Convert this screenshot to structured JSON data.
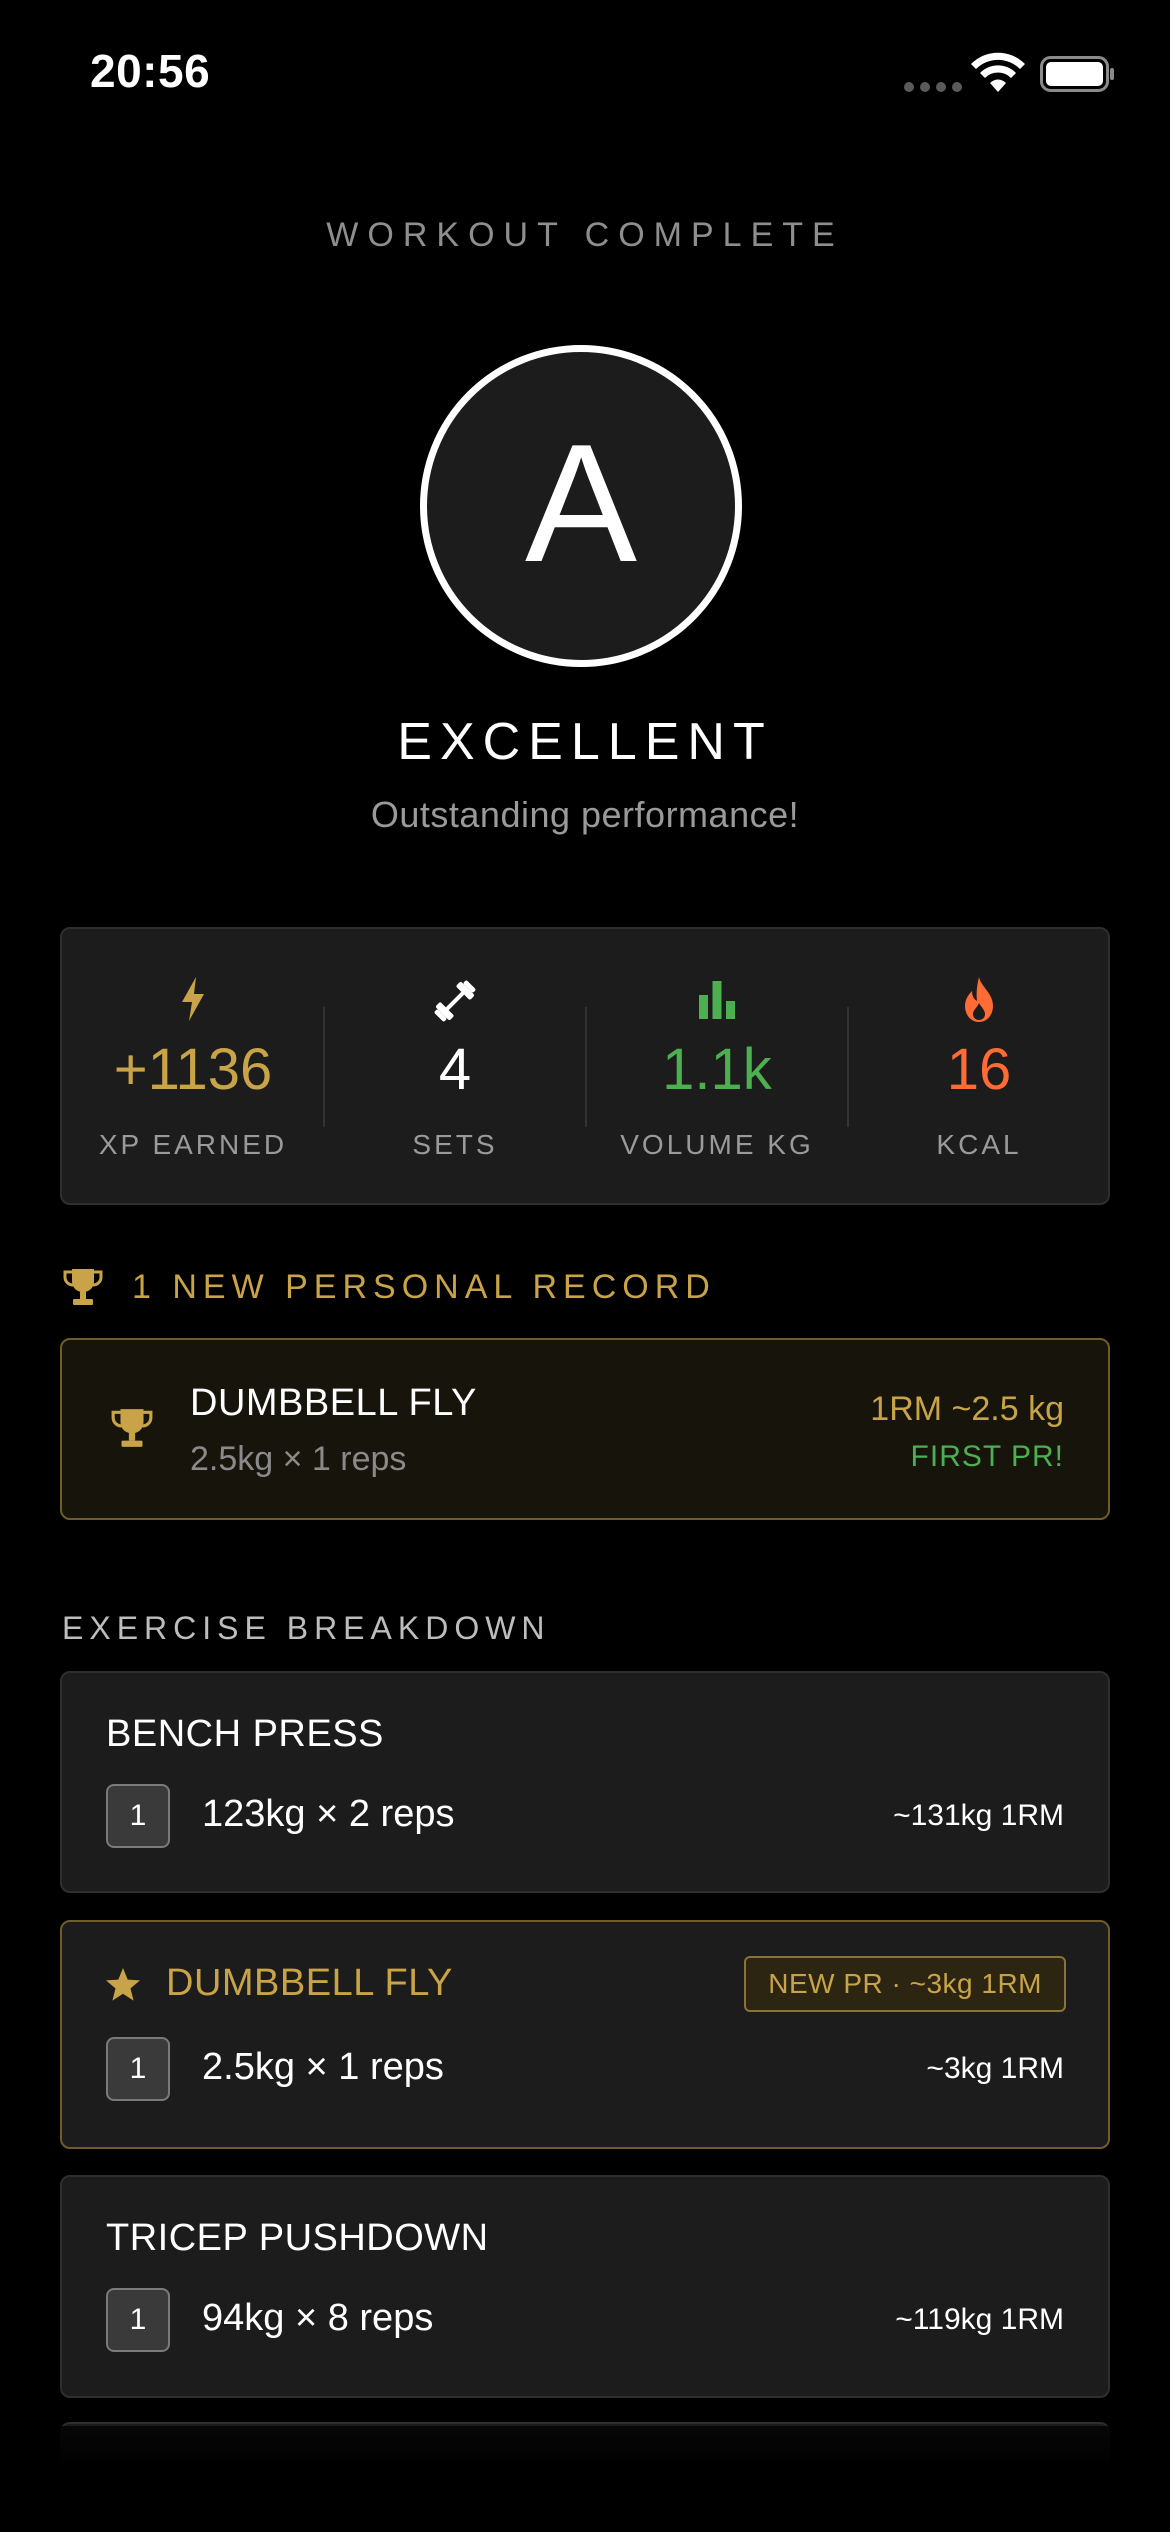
{
  "status_bar": {
    "time": "20:56"
  },
  "header": {
    "eyebrow": "WORKOUT COMPLETE",
    "grade": "A",
    "rating": "EXCELLENT",
    "subtitle": "Outstanding performance!"
  },
  "stats": [
    {
      "icon": "lightning-icon",
      "value": "+1136",
      "label": "XP EARNED",
      "color": "#c9a347"
    },
    {
      "icon": "dumbbell-icon",
      "value": "4",
      "label": "SETS",
      "color": "#ffffff"
    },
    {
      "icon": "bar-chart-icon",
      "value": "1.1k",
      "label": "VOLUME KG",
      "color": "#4caf50"
    },
    {
      "icon": "flame-icon",
      "value": "16",
      "label": "KCAL",
      "color": "#ff6b35"
    }
  ],
  "personal_records": {
    "header": "1 NEW PERSONAL RECORD",
    "items": [
      {
        "name": "DUMBBELL FLY",
        "detail": "2.5kg × 1 reps",
        "one_rm": "1RM ~2.5 kg",
        "tag": "FIRST PR!"
      }
    ]
  },
  "breakdown": {
    "title": "EXERCISE BREAKDOWN",
    "exercises": [
      {
        "name": "BENCH PRESS",
        "is_pr": false,
        "sets": [
          {
            "num": "1",
            "detail": "123kg × 2 reps",
            "one_rm": "~131kg 1RM"
          }
        ]
      },
      {
        "name": "DUMBBELL FLY",
        "is_pr": true,
        "badge": "NEW PR · ~3kg 1RM",
        "sets": [
          {
            "num": "1",
            "detail": "2.5kg × 1 reps",
            "one_rm": "~3kg 1RM"
          }
        ]
      },
      {
        "name": "TRICEP PUSHDOWN",
        "is_pr": false,
        "sets": [
          {
            "num": "1",
            "detail": "94kg × 8 reps",
            "one_rm": "~119kg 1RM"
          }
        ]
      }
    ]
  },
  "colors": {
    "gold": "#c9a347",
    "green": "#4caf50",
    "orange": "#ff6b35",
    "card": "#1c1c1c"
  }
}
